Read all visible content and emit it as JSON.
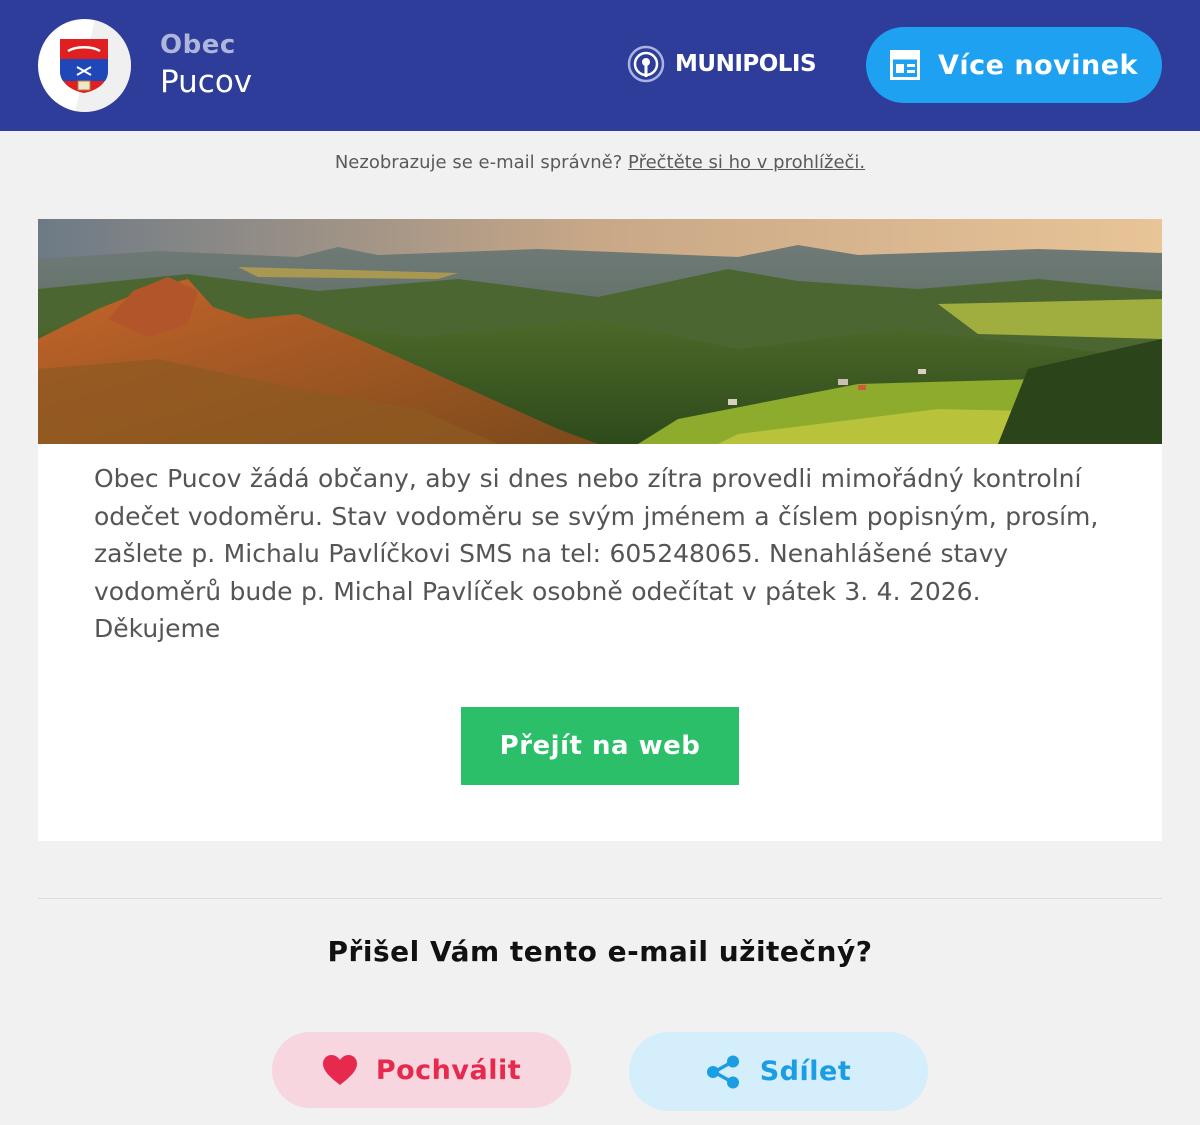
{
  "header": {
    "town_kind": "Obec",
    "town_name": "Pucov",
    "brand": "MUNIPOLIS",
    "more_news_label": "Více novinek"
  },
  "notice": {
    "text": "Nezobrazuje se e-mail správně?",
    "link": "Přečtěte si ho v prohlížeči."
  },
  "article": {
    "body": "Obec Pucov žádá občany, aby si dnes nebo zítra provedli mimořádný kontrolní odečet vodoměru. Stav vodoměru se svým jménem a číslem popisným, prosím, zašlete p. Michalu Pavlíčkovi SMS na tel: 605248065. Nenahlášené stavy vodoměrů bude p. Michal Pavlíček osobně odečítat v pátek 3. 4. 2026. Děkujeme",
    "cta_label": "Přejít na web"
  },
  "feedback": {
    "question": "Přišel Vám tento e-mail užitečný?",
    "praise_label": "Pochválit",
    "share_label": "Sdílet"
  },
  "colors": {
    "header_bg": "#2e3c9a",
    "more_news_bg": "#1da1f0",
    "cta_bg": "#2bbf6a",
    "praise_bg": "#f7d6df",
    "praise_fg": "#e8294e",
    "share_bg": "#d4eefb",
    "share_fg": "#1a9de5"
  },
  "icons": {
    "logo": "town-coat-of-arms-icon",
    "brand": "broadcast-icon",
    "more_news": "newspaper-icon",
    "praise": "heart-icon",
    "share": "share-icon"
  }
}
